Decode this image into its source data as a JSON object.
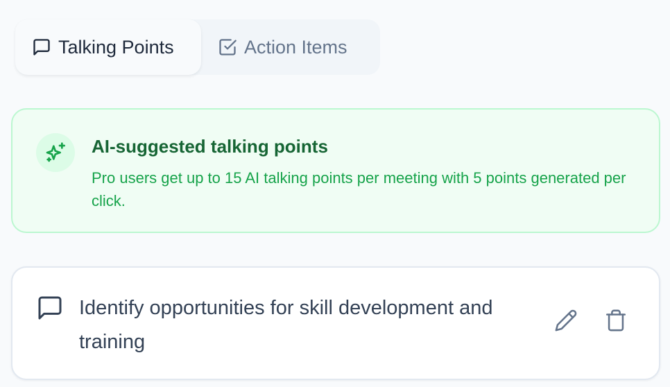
{
  "tabs": [
    {
      "label": "Talking Points",
      "icon": "message-square-icon",
      "active": true
    },
    {
      "label": "Action Items",
      "icon": "check-square-icon",
      "active": false
    }
  ],
  "banner": {
    "icon": "sparkles-icon",
    "title": "AI-suggested talking points",
    "description": "Pro users get up to 15 AI talking points per meeting with 5 points generated per click."
  },
  "talking_points": [
    {
      "icon": "message-square-icon",
      "text": "Identify opportunities for skill development and training",
      "edit_icon": "pencil-icon",
      "delete_icon": "trash-icon"
    }
  ],
  "colors": {
    "page_background": "#f8fafc",
    "banner_background": "#f0fdf4",
    "banner_border": "#bbf7d0",
    "banner_title": "#166534",
    "banner_text": "#16a34a",
    "text_primary": "#334155",
    "text_muted": "#64748b"
  }
}
